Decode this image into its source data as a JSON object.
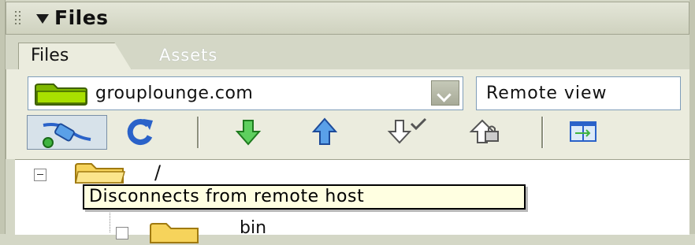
{
  "panel": {
    "title": "Files"
  },
  "tabs": [
    {
      "label": "Files",
      "active": true
    },
    {
      "label": "Assets",
      "active": false
    }
  ],
  "site_select": {
    "value": "grouplounge.com",
    "folder_color": "#7fb800"
  },
  "view_select": {
    "value": "Remote view"
  },
  "toolbar": [
    {
      "icon": "connect-icon",
      "pressed": true
    },
    {
      "icon": "refresh-icon"
    },
    {
      "icon": "get-files-icon"
    },
    {
      "icon": "put-files-icon"
    },
    {
      "icon": "check-out-icon"
    },
    {
      "icon": "check-in-icon"
    },
    {
      "icon": "expand-panel-icon"
    }
  ],
  "tree": {
    "root_label": "/",
    "child_label": "bin"
  },
  "tooltip": {
    "text": "Disconnects from remote host"
  },
  "colors": {
    "folder_yellow": "#f6d35b",
    "accent_blue": "#2a62c9",
    "arrow_green": "#3fb43f"
  }
}
